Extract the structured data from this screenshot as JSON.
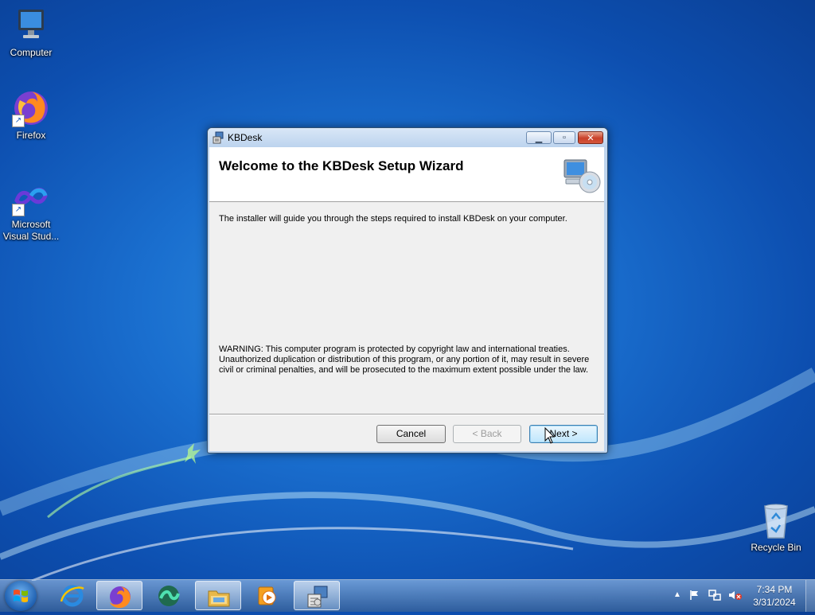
{
  "desktop": {
    "icons": [
      {
        "label": "Computer"
      },
      {
        "label": "Firefox"
      },
      {
        "label_line1": "Microsoft",
        "label_line2": "Visual Stud..."
      },
      {
        "label": "Recycle Bin"
      }
    ]
  },
  "window": {
    "title": "KBDesk",
    "heading": "Welcome to the KBDesk Setup Wizard",
    "intro": "The installer will guide you through the steps required to install KBDesk on your computer.",
    "warning": "WARNING: This computer program is protected by copyright law and international treaties. Unauthorized duplication or distribution of this program, or any portion of it, may result in severe civil or criminal penalties, and will be prosecuted to the maximum extent possible under the law.",
    "buttons": {
      "cancel": "Cancel",
      "back": "< Back",
      "next": "Next >"
    },
    "back_enabled": false
  },
  "taskbar": {
    "items": [
      {
        "icon": "internet-explorer-icon"
      },
      {
        "icon": "firefox-icon",
        "active": true
      },
      {
        "icon": "visual-studio-icon"
      },
      {
        "icon": "file-explorer-icon"
      },
      {
        "icon": "media-player-icon"
      },
      {
        "icon": "installer-icon",
        "active": true
      }
    ],
    "clock": {
      "time": "7:34 PM",
      "date": "3/31/2024"
    }
  },
  "colors": {
    "desktop_blue": "#1a6fcf",
    "next_button": "#bee6fd",
    "close_button": "#c9412a"
  }
}
